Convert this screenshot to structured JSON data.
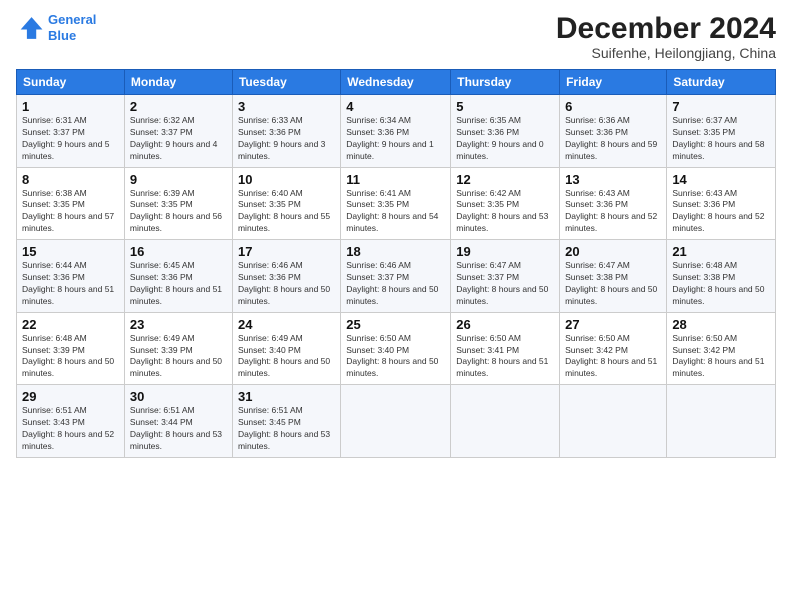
{
  "logo": {
    "line1": "General",
    "line2": "Blue"
  },
  "title": "December 2024",
  "subtitle": "Suifenhe, Heilongjiang, China",
  "days_of_week": [
    "Sunday",
    "Monday",
    "Tuesday",
    "Wednesday",
    "Thursday",
    "Friday",
    "Saturday"
  ],
  "weeks": [
    [
      {
        "num": "1",
        "sunrise": "6:31 AM",
        "sunset": "3:37 PM",
        "daylight": "9 hours and 5 minutes."
      },
      {
        "num": "2",
        "sunrise": "6:32 AM",
        "sunset": "3:37 PM",
        "daylight": "9 hours and 4 minutes."
      },
      {
        "num": "3",
        "sunrise": "6:33 AM",
        "sunset": "3:36 PM",
        "daylight": "9 hours and 3 minutes."
      },
      {
        "num": "4",
        "sunrise": "6:34 AM",
        "sunset": "3:36 PM",
        "daylight": "9 hours and 1 minute."
      },
      {
        "num": "5",
        "sunrise": "6:35 AM",
        "sunset": "3:36 PM",
        "daylight": "9 hours and 0 minutes."
      },
      {
        "num": "6",
        "sunrise": "6:36 AM",
        "sunset": "3:36 PM",
        "daylight": "8 hours and 59 minutes."
      },
      {
        "num": "7",
        "sunrise": "6:37 AM",
        "sunset": "3:35 PM",
        "daylight": "8 hours and 58 minutes."
      }
    ],
    [
      {
        "num": "8",
        "sunrise": "6:38 AM",
        "sunset": "3:35 PM",
        "daylight": "8 hours and 57 minutes."
      },
      {
        "num": "9",
        "sunrise": "6:39 AM",
        "sunset": "3:35 PM",
        "daylight": "8 hours and 56 minutes."
      },
      {
        "num": "10",
        "sunrise": "6:40 AM",
        "sunset": "3:35 PM",
        "daylight": "8 hours and 55 minutes."
      },
      {
        "num": "11",
        "sunrise": "6:41 AM",
        "sunset": "3:35 PM",
        "daylight": "8 hours and 54 minutes."
      },
      {
        "num": "12",
        "sunrise": "6:42 AM",
        "sunset": "3:35 PM",
        "daylight": "8 hours and 53 minutes."
      },
      {
        "num": "13",
        "sunrise": "6:43 AM",
        "sunset": "3:36 PM",
        "daylight": "8 hours and 52 minutes."
      },
      {
        "num": "14",
        "sunrise": "6:43 AM",
        "sunset": "3:36 PM",
        "daylight": "8 hours and 52 minutes."
      }
    ],
    [
      {
        "num": "15",
        "sunrise": "6:44 AM",
        "sunset": "3:36 PM",
        "daylight": "8 hours and 51 minutes."
      },
      {
        "num": "16",
        "sunrise": "6:45 AM",
        "sunset": "3:36 PM",
        "daylight": "8 hours and 51 minutes."
      },
      {
        "num": "17",
        "sunrise": "6:46 AM",
        "sunset": "3:36 PM",
        "daylight": "8 hours and 50 minutes."
      },
      {
        "num": "18",
        "sunrise": "6:46 AM",
        "sunset": "3:37 PM",
        "daylight": "8 hours and 50 minutes."
      },
      {
        "num": "19",
        "sunrise": "6:47 AM",
        "sunset": "3:37 PM",
        "daylight": "8 hours and 50 minutes."
      },
      {
        "num": "20",
        "sunrise": "6:47 AM",
        "sunset": "3:38 PM",
        "daylight": "8 hours and 50 minutes."
      },
      {
        "num": "21",
        "sunrise": "6:48 AM",
        "sunset": "3:38 PM",
        "daylight": "8 hours and 50 minutes."
      }
    ],
    [
      {
        "num": "22",
        "sunrise": "6:48 AM",
        "sunset": "3:39 PM",
        "daylight": "8 hours and 50 minutes."
      },
      {
        "num": "23",
        "sunrise": "6:49 AM",
        "sunset": "3:39 PM",
        "daylight": "8 hours and 50 minutes."
      },
      {
        "num": "24",
        "sunrise": "6:49 AM",
        "sunset": "3:40 PM",
        "daylight": "8 hours and 50 minutes."
      },
      {
        "num": "25",
        "sunrise": "6:50 AM",
        "sunset": "3:40 PM",
        "daylight": "8 hours and 50 minutes."
      },
      {
        "num": "26",
        "sunrise": "6:50 AM",
        "sunset": "3:41 PM",
        "daylight": "8 hours and 51 minutes."
      },
      {
        "num": "27",
        "sunrise": "6:50 AM",
        "sunset": "3:42 PM",
        "daylight": "8 hours and 51 minutes."
      },
      {
        "num": "28",
        "sunrise": "6:50 AM",
        "sunset": "3:42 PM",
        "daylight": "8 hours and 51 minutes."
      }
    ],
    [
      {
        "num": "29",
        "sunrise": "6:51 AM",
        "sunset": "3:43 PM",
        "daylight": "8 hours and 52 minutes."
      },
      {
        "num": "30",
        "sunrise": "6:51 AM",
        "sunset": "3:44 PM",
        "daylight": "8 hours and 53 minutes."
      },
      {
        "num": "31",
        "sunrise": "6:51 AM",
        "sunset": "3:45 PM",
        "daylight": "8 hours and 53 minutes."
      },
      null,
      null,
      null,
      null
    ]
  ]
}
